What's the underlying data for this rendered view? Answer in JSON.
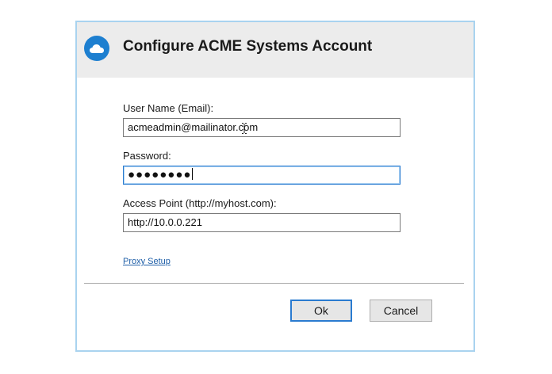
{
  "dialog": {
    "title": "Configure ACME Systems Account",
    "icon": "cloud-icon",
    "accent_color": "#1d7fd0"
  },
  "form": {
    "username_label": "User Name (Email):",
    "username_value": "acmeadmin@mailinator.com",
    "password_label": "Password:",
    "password_masked": "●●●●●●●●",
    "access_point_label": "Access Point (http://myhost.com):",
    "access_point_value": "http://10.0.0.221"
  },
  "links": {
    "proxy_setup": "Proxy Setup"
  },
  "buttons": {
    "ok": "Ok",
    "cancel": "Cancel"
  }
}
